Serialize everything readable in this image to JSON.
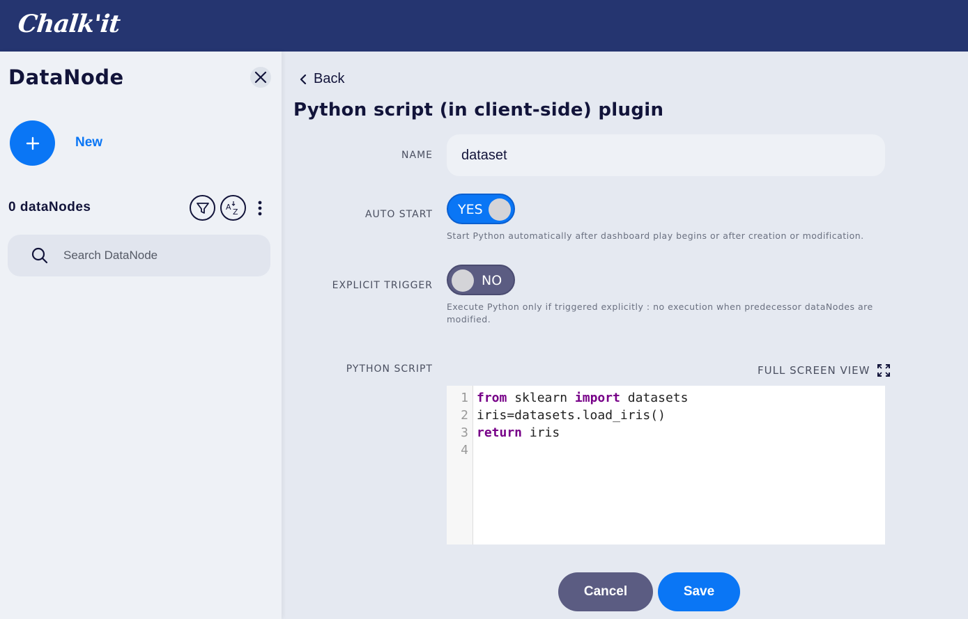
{
  "app": {
    "logo_text": "Chalk'it"
  },
  "sidebar": {
    "title": "DataNode",
    "new_label": "New",
    "count_label": "0 dataNodes",
    "search_placeholder": "Search DataNode"
  },
  "main": {
    "back_label": "Back",
    "title": "Python script (in client-side) plugin",
    "fields": {
      "name_label": "NAME",
      "name_value": "dataset",
      "auto_start_label": "AUTO START",
      "auto_start_value": "YES",
      "auto_start_hint": "Start Python automatically after dashboard play begins or after creation or modification.",
      "explicit_trigger_label": "EXPLICIT TRIGGER",
      "explicit_trigger_value": "NO",
      "explicit_trigger_hint": "Execute Python only if triggered explicitly : no execution when predecessor dataNodes are modified.",
      "python_script_label": "PYTHON SCRIPT",
      "full_screen_label": "FULL SCREEN VIEW"
    },
    "editor": {
      "line_numbers": [
        "1",
        "2",
        "3",
        "4"
      ],
      "lines": [
        {
          "kw1": "from",
          "t1": " sklearn ",
          "kw2": "import",
          "t2": " datasets"
        },
        {
          "text": "iris=datasets.load_iris()"
        },
        {
          "kw1": "return",
          "t1": " iris"
        },
        {
          "text": ""
        }
      ]
    },
    "buttons": {
      "cancel": "Cancel",
      "save": "Save"
    }
  },
  "colors": {
    "header": "#253570",
    "accent": "#0a76f5",
    "muted_button": "#5b5c82",
    "keyword": "#770088"
  },
  "icons": [
    "close-icon",
    "plus-icon",
    "filter-icon",
    "sort-az-icon",
    "more-vert-icon",
    "search-icon",
    "chevron-left-icon",
    "fullscreen-icon"
  ]
}
